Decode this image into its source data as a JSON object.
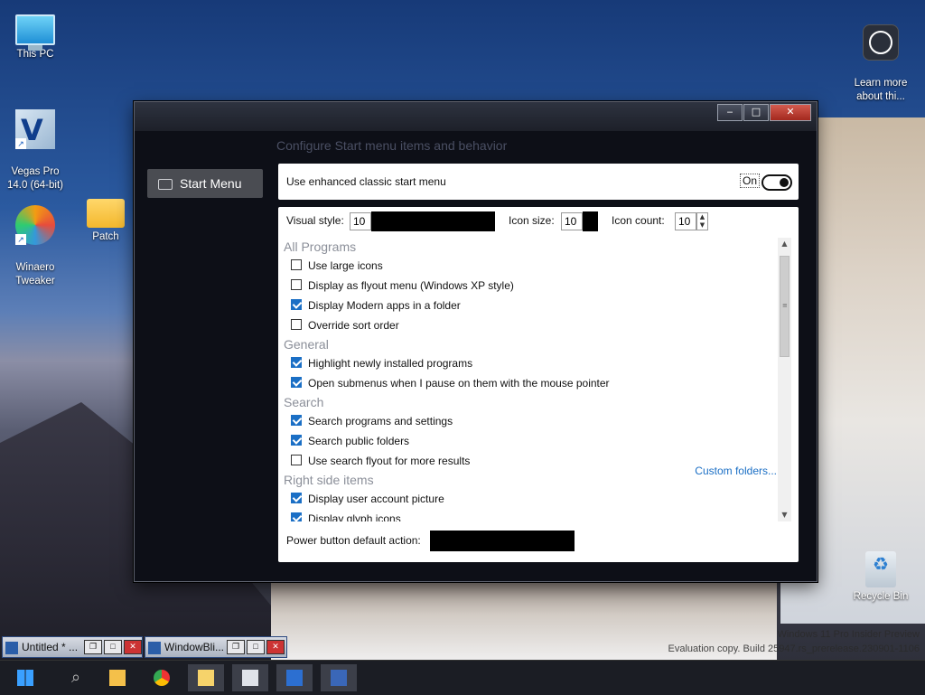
{
  "desktop": {
    "icons": [
      {
        "label": "This PC",
        "icon": "monitor-icon"
      },
      {
        "label": "Vegas Pro\n14.0 (64-bit)",
        "icon": "vegas-pro-icon"
      },
      {
        "label": "Winaero\nTweaker",
        "icon": "winaero-tweaker-icon"
      },
      {
        "label": "Patch",
        "icon": "folder-icon"
      },
      {
        "label": "Learn more\nabout thi...",
        "icon": "learn-more-icon"
      },
      {
        "label": "Recycle Bin",
        "icon": "recycle-bin-icon"
      }
    ],
    "watermark_line1": "Windows 11 Pro Insider Preview",
    "watermark_line2": "Evaluation copy. Build 25947.rs_prerelease.230901-1106"
  },
  "window": {
    "heading": "Configure Start menu items and behavior",
    "side_tab": "Start Menu",
    "title_buttons": {
      "minimize": "‒",
      "maximize": "□",
      "close": "✕"
    },
    "toggle": {
      "label": "Use enhanced classic start menu",
      "state": "On"
    },
    "visual_style": {
      "label": "Visual style:",
      "value": "10"
    },
    "icon_size": {
      "label": "Icon size:",
      "value": "10"
    },
    "icon_count": {
      "label": "Icon count:",
      "value": "10"
    },
    "sections": [
      {
        "title": "All Programs",
        "items": [
          {
            "label": "Use large icons",
            "checked": false
          },
          {
            "label": "Display as flyout menu (Windows XP style)",
            "checked": false
          },
          {
            "label": "Display Modern apps in a folder",
            "checked": true
          },
          {
            "label": "Override sort order",
            "checked": false
          }
        ]
      },
      {
        "title": "General",
        "items": [
          {
            "label": "Highlight newly installed programs",
            "checked": true
          },
          {
            "label": "Open submenus when I pause on them with the mouse pointer",
            "checked": true
          }
        ]
      },
      {
        "title": "Search",
        "items": [
          {
            "label": "Search programs and settings",
            "checked": true
          },
          {
            "label": "Search public folders",
            "checked": true
          },
          {
            "label": "Use search flyout for more results",
            "checked": false
          }
        ]
      },
      {
        "title": "Right side items",
        "link": "Custom folders...",
        "items": [
          {
            "label": "Display user account picture",
            "checked": true
          },
          {
            "label": "Display glyph icons",
            "checked": true
          }
        ]
      }
    ],
    "power_button_label": "Power button default action:"
  },
  "minimized_windows": [
    {
      "title": "Untitled * ..."
    },
    {
      "title": "WindowBli..."
    }
  ],
  "taskbar": {
    "items": [
      "start-icon",
      "search-icon",
      "file-explorer-icon",
      "chrome-icon",
      "notepad-icon",
      "windowblinds-icon",
      "vegas-pro-icon",
      "app-icon"
    ]
  }
}
